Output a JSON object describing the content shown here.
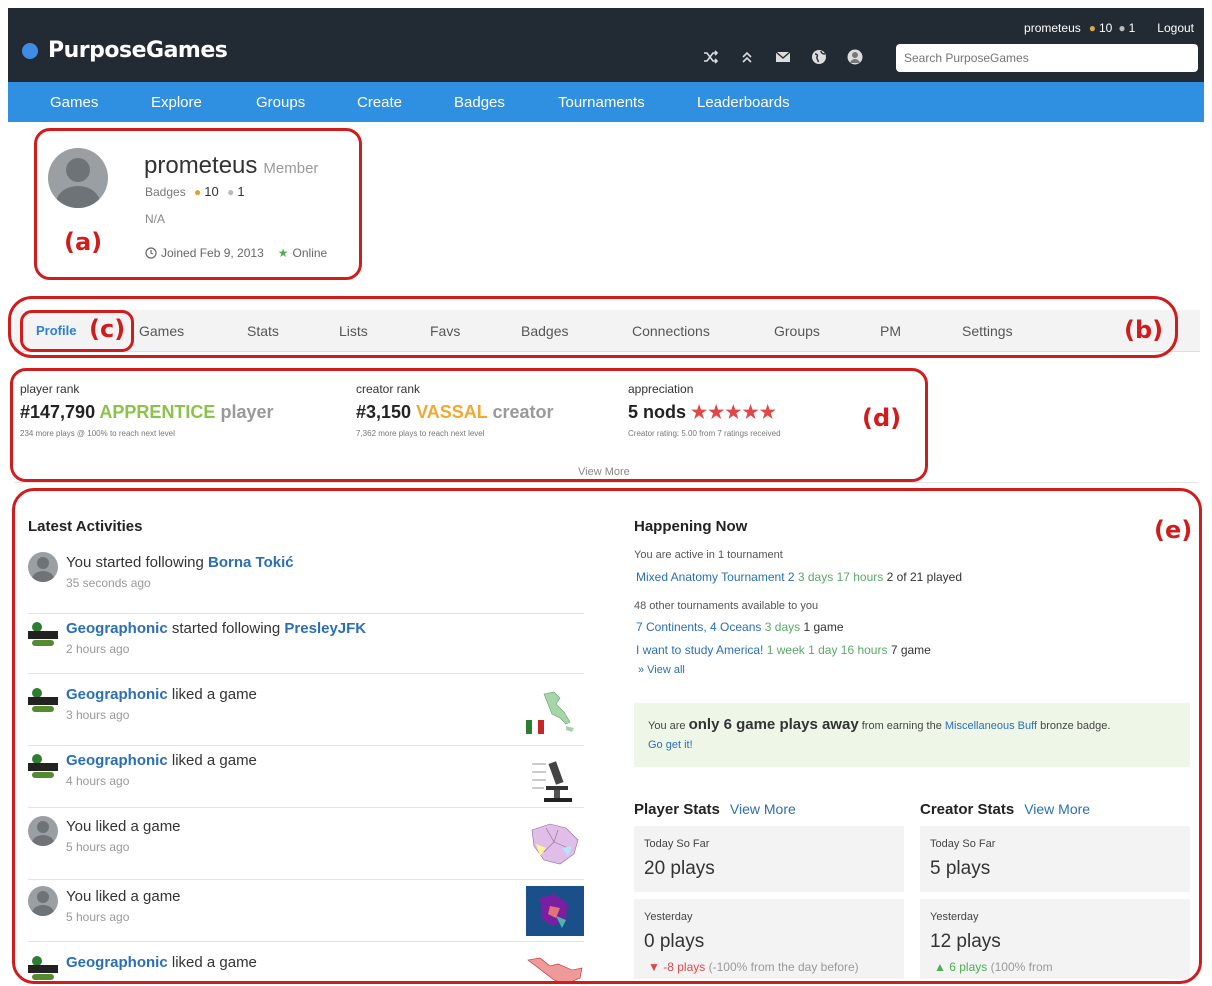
{
  "header": {
    "brand": "PurposeGames",
    "username": "prometeus",
    "gold_badges": "10",
    "silver_badges": "1",
    "logout_label": "Logout",
    "search_placeholder": "Search PurposeGames",
    "icons": [
      "shuffle-icon",
      "chevrons-up-icon",
      "mail-icon",
      "globe-icon",
      "user-avatar-icon"
    ]
  },
  "nav": [
    "Games",
    "Explore",
    "Groups",
    "Create",
    "Badges",
    "Tournaments",
    "Leaderboards"
  ],
  "profile": {
    "name": "prometeus",
    "role": "Member",
    "badges_label": "Badges",
    "gold": "10",
    "silver": "1",
    "bio": "N/A",
    "joined": "Joined Feb 9, 2013",
    "status": "Online"
  },
  "annotations": {
    "a": "(a)",
    "b": "(b)",
    "c": "(c)",
    "d": "(d)",
    "e": "(e)"
  },
  "tabs": [
    "Profile",
    "Games",
    "Stats",
    "Lists",
    "Favs",
    "Badges",
    "Connections",
    "Groups",
    "PM",
    "Settings"
  ],
  "ranks": {
    "player": {
      "label": "player rank",
      "value": "#147,790",
      "tier": "APPRENTICE",
      "suffix": "player",
      "note": "234 more plays @ 100% to reach next level"
    },
    "creator": {
      "label": "creator rank",
      "value": "#3,150",
      "tier": "VASSAL",
      "suffix": "creator",
      "note": "7,362 more plays to reach next level"
    },
    "appreciation": {
      "label": "appreciation",
      "value": "5 nods",
      "stars": "★★★★★",
      "note": "Creator rating: 5.00 from 7 ratings received"
    },
    "view_more": "View More"
  },
  "activities": {
    "title": "Latest Activities",
    "items": [
      {
        "pre": "You started following ",
        "link": "Borna Tokić",
        "post": "",
        "time": "35 seconds ago"
      },
      {
        "pre": "",
        "link": "Geographonic",
        "post": " started following ",
        "link2": "PresleyJFK",
        "time": "2 hours ago"
      },
      {
        "pre": "",
        "link": "Geographonic",
        "post": " liked a game",
        "time": "3 hours ago"
      },
      {
        "pre": "",
        "link": "Geographonic",
        "post": " liked a game",
        "time": "4 hours ago"
      },
      {
        "pre": "You liked a game",
        "link": "",
        "post": "",
        "time": "5 hours ago"
      },
      {
        "pre": "You liked a game",
        "link": "",
        "post": "",
        "time": "5 hours ago"
      },
      {
        "pre": "",
        "link": "Geographonic",
        "post": " liked a game",
        "time": ""
      }
    ]
  },
  "happening": {
    "title": "Happening Now",
    "active_text": "You are active in 1 tournament",
    "active": [
      {
        "name": "Mixed Anatomy Tournament 2",
        "time": "3 days 17 hours",
        "extra": "2 of 21 played"
      }
    ],
    "other_text": "48 other tournaments available to you",
    "others": [
      {
        "name": "7 Continents, 4 Oceans",
        "time": "3 days",
        "extra": "1 game"
      },
      {
        "name": "I want to study America!",
        "time": "1 week 1 day 16 hours",
        "extra": "7 game"
      }
    ],
    "view_all": "» View all"
  },
  "badge_promo": {
    "pre": "You are ",
    "bold": "only 6 game plays away",
    "mid": " from earning the ",
    "link": "Miscellaneous Buff",
    "post": " bronze badge.",
    "cta": "Go get it!"
  },
  "player_stats": {
    "title": "Player Stats",
    "view_more": "View More",
    "today_label": "Today So Far",
    "today_value": "20 plays",
    "yesterday_label": "Yesterday",
    "yesterday_value": "0 plays",
    "delta_arrow": "▼",
    "delta": "-8 plays",
    "delta_note": "(-100% from the day before)"
  },
  "creator_stats": {
    "title": "Creator Stats",
    "view_more": "View More",
    "today_label": "Today So Far",
    "today_value": "5 plays",
    "yesterday_label": "Yesterday",
    "yesterday_value": "12 plays",
    "delta_arrow": "▲",
    "delta": "6 plays",
    "delta_note": "(100% from"
  },
  "colors": {
    "topbar": "#222a33",
    "nav": "#2f8fe1",
    "annotation": "#d01c1c",
    "link": "#2a6fb5",
    "apprentice": "#8bc34a",
    "vassal": "#f0a830",
    "stars": "#e04848"
  }
}
